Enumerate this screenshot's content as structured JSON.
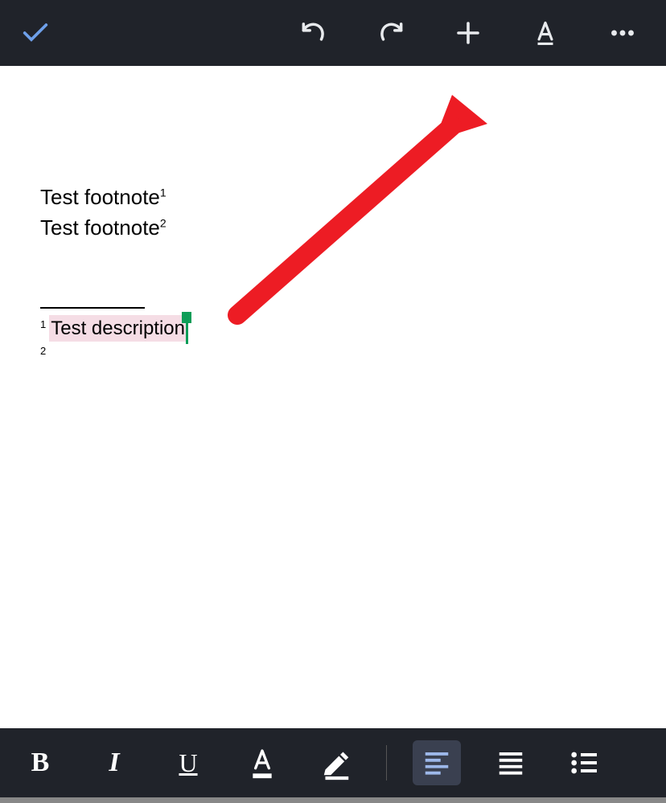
{
  "toolbar_top": {
    "done": "done",
    "undo": "undo",
    "redo": "redo",
    "add": "add",
    "text_format": "text-format",
    "more": "more"
  },
  "document": {
    "line1_text": "Test footnote",
    "line1_sup": "1",
    "line2_text": "Test footnote",
    "line2_sup": "2",
    "footnotes": {
      "fn1_num": "1",
      "fn1_text": " Test description",
      "fn2_num": "2",
      "fn2_text": ""
    }
  },
  "toolbar_bottom": {
    "bold": "B",
    "italic": "I",
    "underline": "U",
    "text_color": "A",
    "highlight": "highlight",
    "align_left": "align-left",
    "align_justify": "align-justify",
    "bulleted_list": "bulleted-list"
  }
}
